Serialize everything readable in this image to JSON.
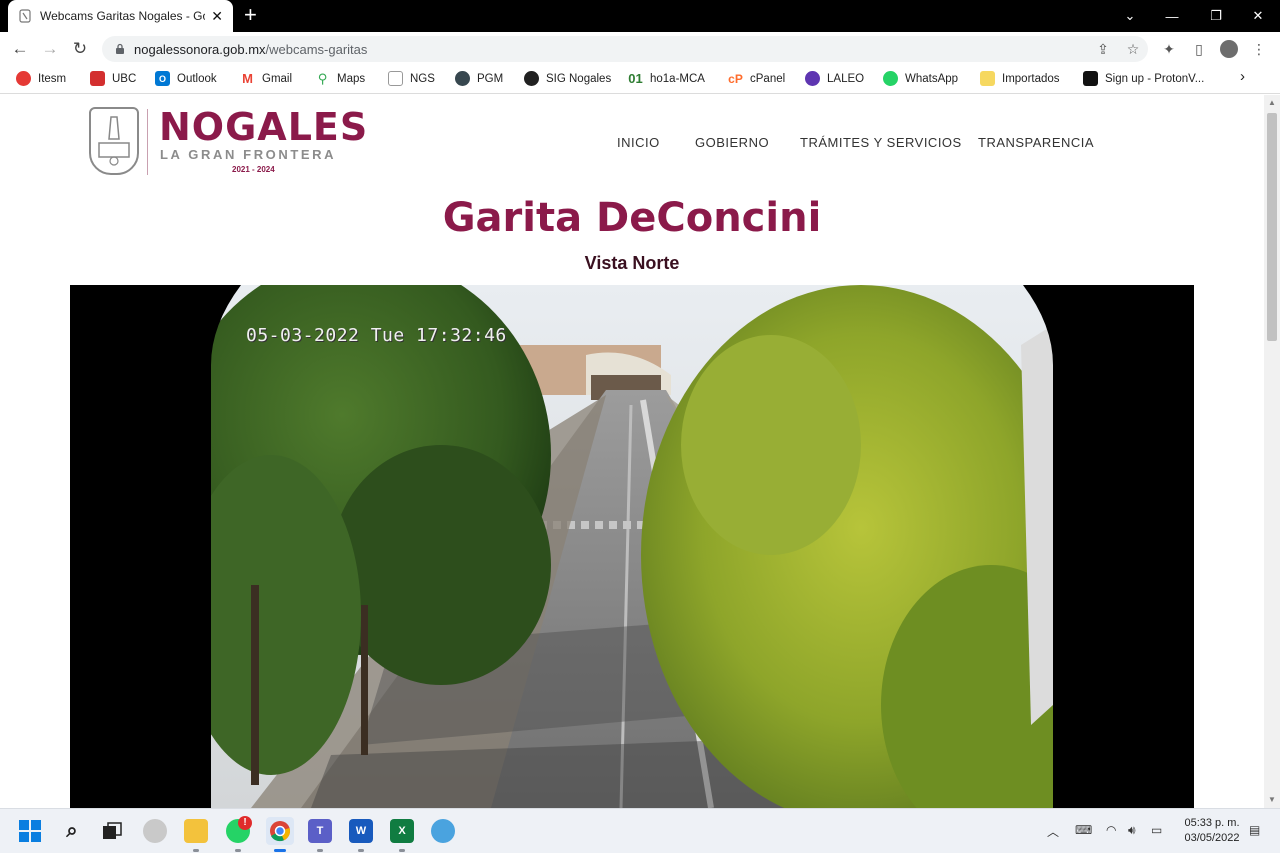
{
  "browser": {
    "tab_title": "Webcams Garitas Nogales - Gobi",
    "url_host": "nogalessonora.gob.mx",
    "url_path": "/webcams-garitas"
  },
  "bookmarks": [
    {
      "label": "Itesm",
      "color": "#e53935",
      "icon": "itesm-icon"
    },
    {
      "label": "UBC",
      "color": "#d32f2f",
      "icon": "ubc-icon"
    },
    {
      "label": "Outlook",
      "color": "#0078d4",
      "icon": "outlook-icon"
    },
    {
      "label": "Gmail",
      "color": "#ea4335",
      "icon": "gmail-icon"
    },
    {
      "label": "Maps",
      "color": "#34a853",
      "icon": "maps-icon"
    },
    {
      "label": "NGS",
      "color": "#9e9e9e",
      "icon": "ngs-icon"
    },
    {
      "label": "PGM",
      "color": "#37474f",
      "icon": "pgm-icon"
    },
    {
      "label": "SIG Nogales",
      "color": "#212121",
      "icon": "sig-icon"
    },
    {
      "label": "ho1a-MCA",
      "color": "#2e7d32",
      "icon": "ho1a-icon"
    },
    {
      "label": "cPanel",
      "color": "#ff6c2c",
      "icon": "cpanel-icon"
    },
    {
      "label": "LALEO",
      "color": "#5e35b1",
      "icon": "laleo-icon"
    },
    {
      "label": "WhatsApp",
      "color": "#25d366",
      "icon": "whatsapp-icon"
    },
    {
      "label": "Importados",
      "color": "#f6d860",
      "icon": "folder-icon"
    },
    {
      "label": "Sign up - ProtonV...",
      "color": "#111111",
      "icon": "proton-icon"
    }
  ],
  "site": {
    "logo_name": "NOGALES",
    "logo_tagline": "LA GRAN FRONTERA",
    "logo_years": "2021 - 2024",
    "nav": [
      "INICIO",
      "GOBIERNO",
      "TRÁMITES Y SERVICIOS",
      "TRANSPARENCIA"
    ],
    "title": "Garita DeConcini",
    "subtitle": "Vista Norte",
    "camera_timestamp": "05-03-2022 Tue 17:32:46"
  },
  "taskbar": {
    "time": "05:33 p. m.",
    "date": "03/05/2022",
    "whatsapp_badge": "!"
  },
  "colors": {
    "brand": "#8b1a4a",
    "titlebar": "#000000"
  }
}
